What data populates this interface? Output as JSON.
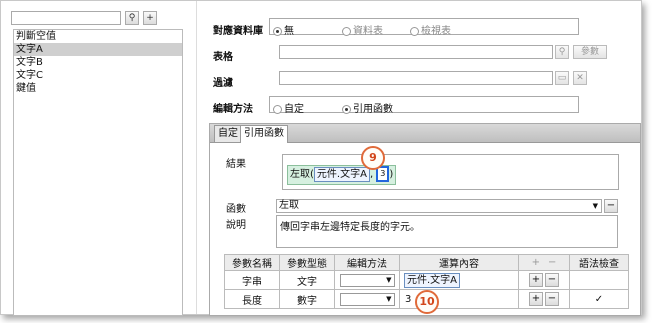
{
  "left_panel": {
    "search_value": "",
    "search_button": "⚲",
    "add_button": "+",
    "items": [
      {
        "label": "判斷空值",
        "selected": false
      },
      {
        "label": "文字A",
        "selected": true
      },
      {
        "label": "文字B",
        "selected": false
      },
      {
        "label": "文字C",
        "selected": false
      },
      {
        "label": "鍵值",
        "selected": false
      }
    ]
  },
  "form": {
    "source_label": "對應資料庫",
    "source_options": [
      "無",
      "資料表",
      "檢視表"
    ],
    "source_selected": "無",
    "table_label": "表格",
    "table_value": "",
    "param_button": "參數",
    "filter_label": "過濾",
    "filter_value": "",
    "filter_clear": "✕",
    "edit_method_label": "編輯方法",
    "edit_options": [
      "自定",
      "引用函數"
    ],
    "edit_selected": "引用函數"
  },
  "tabs": [
    "自定",
    "引用函數"
  ],
  "active_tab": "引用函數",
  "function_panel": {
    "result_label": "結果",
    "formula_func": "左取(",
    "formula_arg1": "元件.文字A",
    "formula_sep": ",",
    "formula_arg2": "3",
    "formula_close": ")",
    "function_label": "函數",
    "function_value": "左取",
    "description_label": "說明",
    "description_value": "傳回字串左邊特定長度的字元。"
  },
  "callouts": [
    "9",
    "10"
  ],
  "param_table": {
    "headers": [
      "參數名稱",
      "參數型態",
      "編輯方法",
      "運算內容",
      "+",
      "−",
      "語法檢查"
    ],
    "rows": [
      {
        "name": "字串",
        "type": "文字",
        "method": "",
        "content": "元件.文字A",
        "check": ""
      },
      {
        "name": "長度",
        "type": "數字",
        "method": "",
        "content": "3",
        "check": "✓"
      }
    ]
  }
}
